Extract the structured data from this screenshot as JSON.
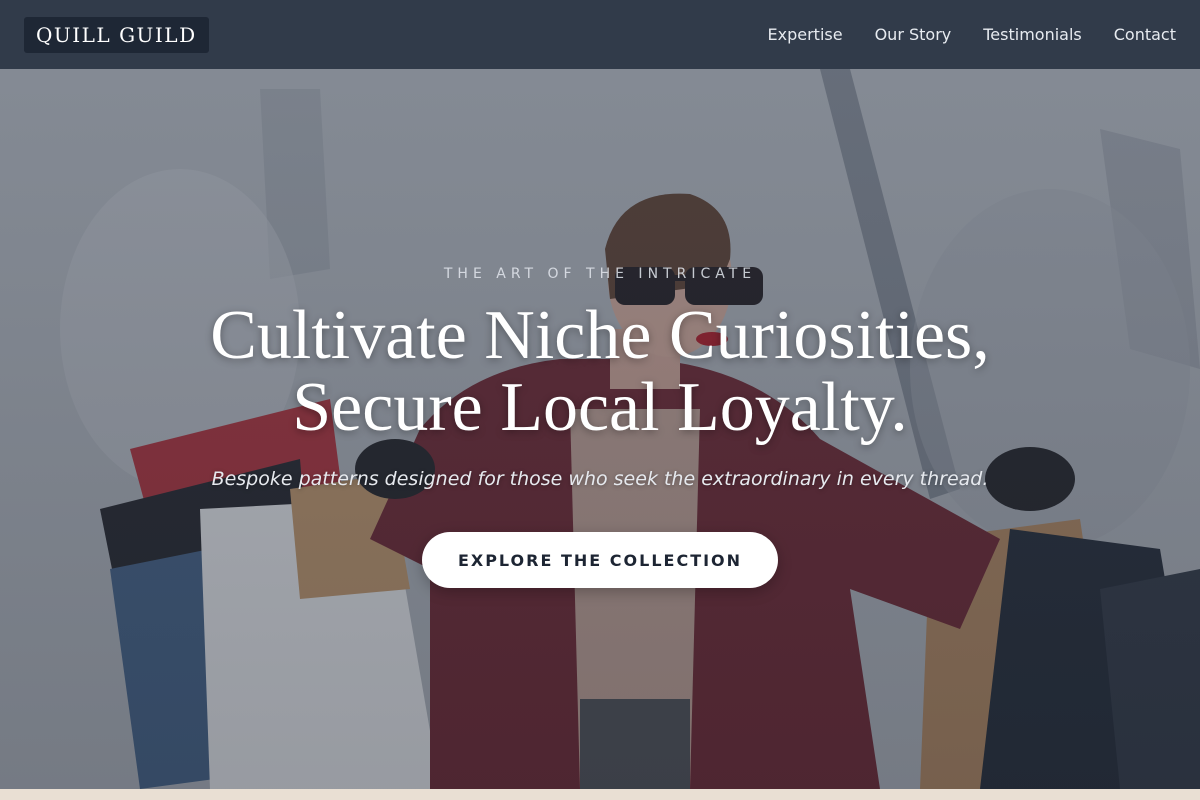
{
  "brand": {
    "logo_text": "QUILL GUILD"
  },
  "nav": {
    "items": [
      {
        "label": "Expertise"
      },
      {
        "label": "Our Story"
      },
      {
        "label": "Testimonials"
      },
      {
        "label": "Contact"
      }
    ]
  },
  "hero": {
    "eyebrow": "THE ART OF THE INTRICATE",
    "headline_line1": "Cultivate Niche Curiosities,",
    "headline_line2": "Secure Local Loyalty.",
    "subtitle": "Bespoke patterns designed for those who seek the extraordinary in every thread.",
    "cta_label": "EXPLORE THE COLLECTION",
    "image_subject": "woman-with-shopping-bags"
  },
  "colors": {
    "navbar_bg": "#313b4a",
    "logo_bg": "#1e2735",
    "cta_bg": "#ffffff",
    "cta_text": "#1d2533",
    "accent_red": "#7a1f2b"
  }
}
